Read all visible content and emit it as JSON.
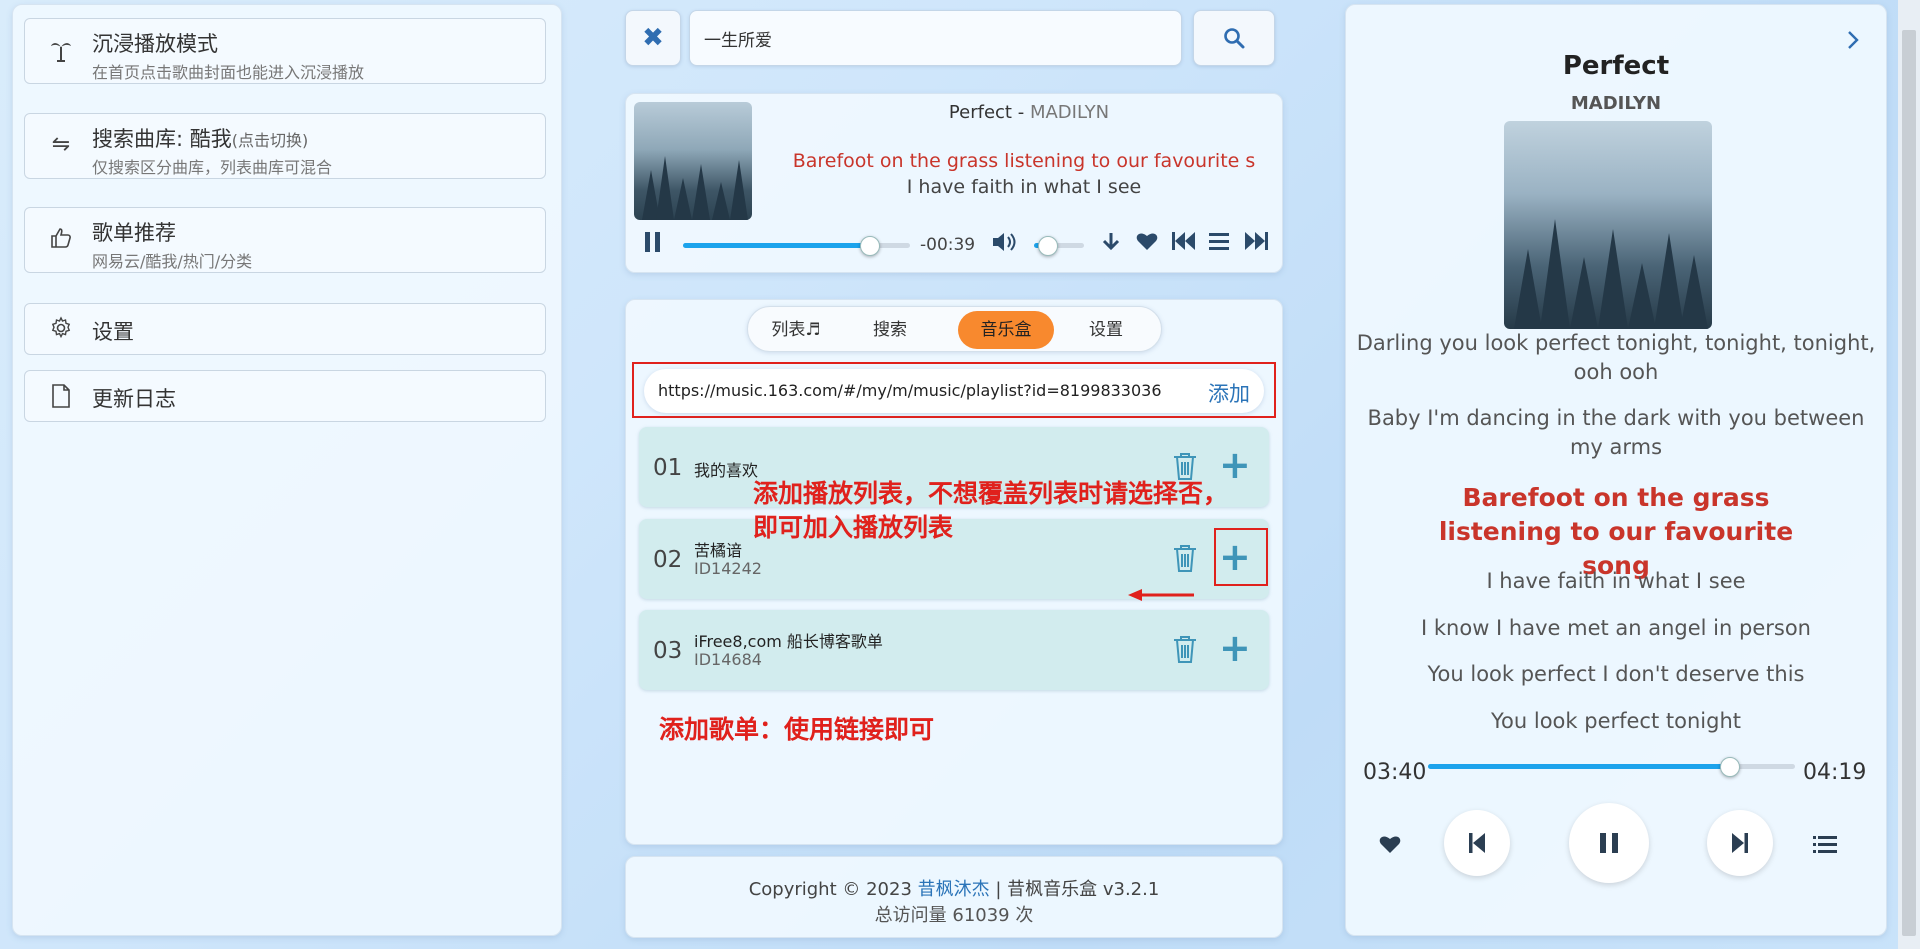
{
  "left_menu": [
    {
      "title": "沉浸播放模式",
      "sub": "在首页点击歌曲封面也能进入沉浸播放",
      "icon": "palm-tree-icon"
    },
    {
      "title": "搜索曲库: 酷我",
      "title_hint": "(点击切换)",
      "sub": "仅搜索区分曲库，列表曲库可混合",
      "icon": "swap-arrows-icon"
    },
    {
      "title": "歌单推荐",
      "sub": "网易云/酷我/热门/分类",
      "icon": "thumbs-up-icon"
    },
    {
      "title": "设置",
      "icon": "gear-icon"
    },
    {
      "title": "更新日志",
      "icon": "document-icon"
    }
  ],
  "search": {
    "value": "一生所爱"
  },
  "player": {
    "song": "Perfect",
    "separator": " - ",
    "artist": "MADILYN",
    "lyric_current": "Barefoot on the grass listening to our favourite s",
    "lyric_next": "I have faith in what I see",
    "remaining": "-00:39",
    "progress": 0.82,
    "volume": 0.25
  },
  "tabs": [
    {
      "label": "列表♬",
      "active": false
    },
    {
      "label": "搜索",
      "active": false
    },
    {
      "label": "音乐盒",
      "active": true
    },
    {
      "label": "设置",
      "active": false
    }
  ],
  "musicbox": {
    "url": "https://music.163.com/#/my/m/music/playlist?id=8199833036",
    "add_label": "添加",
    "playlists": [
      {
        "num": "01",
        "name": "我的喜欢",
        "id": ""
      },
      {
        "num": "02",
        "name": "苦橘谙",
        "id": "ID14242"
      },
      {
        "num": "03",
        "name": "iFree8,com 船长博客歌单",
        "id": "ID14684"
      }
    ],
    "annotation_1_line1": "添加播放列表，不想覆盖列表时请选择否，",
    "annotation_1_line2": "即可加入播放列表",
    "annotation_2": "添加歌单：使用链接即可"
  },
  "footer": {
    "copyright_prefix": "Copyright © 2023 ",
    "author": "昔枫沐杰",
    "copyright_suffix": " | 昔枫音乐盒 v3.2.1",
    "visits": "总访问量 61039 次"
  },
  "now_playing": {
    "title": "Perfect",
    "artist": "MADILYN",
    "lyrics": [
      "Darling you look perfect tonight, tonight, tonight, ooh ooh",
      "Baby I'm dancing in the dark with you between my arms",
      "Barefoot on the grass listening to our favourite song",
      "I have faith in what I see",
      "I know I have met an angel in person",
      "You look perfect I don't deserve this",
      "You look perfect tonight"
    ],
    "current_lyric_index": 2,
    "elapsed": "03:40",
    "total": "04:19",
    "progress": 0.82
  },
  "colors": {
    "accent": "#1ca3ec",
    "tab_active": "#f8892e",
    "annotation": "#e0211c",
    "lyric_current": "#c9352b",
    "link": "#2b74b8"
  }
}
